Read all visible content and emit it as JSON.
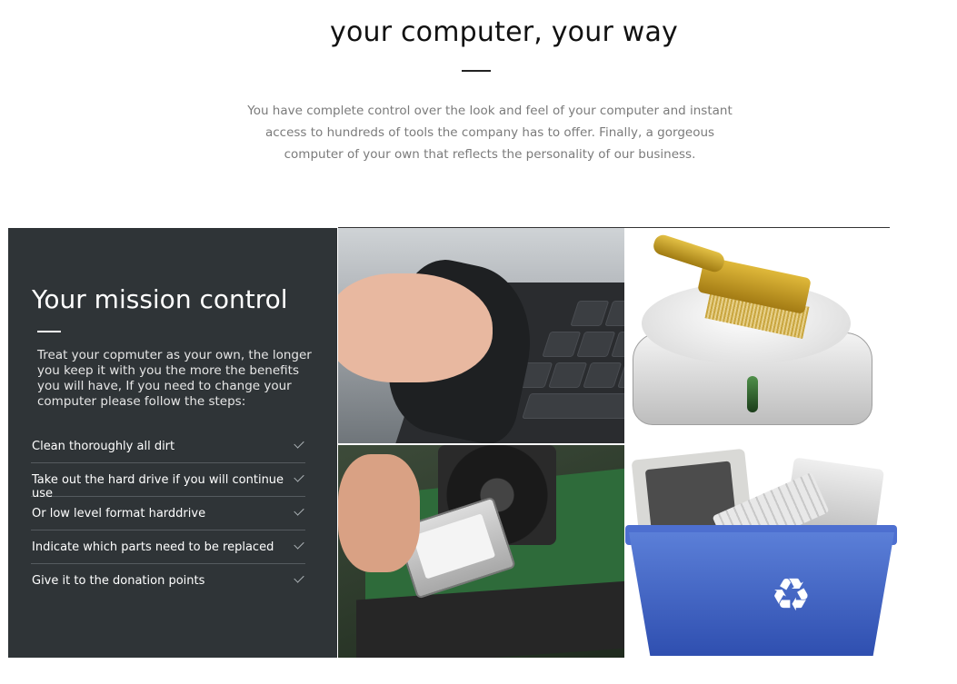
{
  "hero": {
    "title": "your computer, your way",
    "text": "You have complete control over the look and feel of your computer and instant access to hundreds of tools the company has to offer. Finally, a gorgeous computer of your own that reflects the personality of our business."
  },
  "panel": {
    "title": "Your mission control",
    "description": "Treat your copmuter as your own, the longer you keep it with you the more the benefits you will have, If you need to change your computer please follow the steps:",
    "steps": [
      {
        "label": "Clean thoroughly all dirt",
        "icon": "check-icon"
      },
      {
        "label": "Take out the hard drive if you will continue use",
        "icon": "check-icon"
      },
      {
        "label": "Or low level format harddrive",
        "icon": "check-icon"
      },
      {
        "label": "Indicate which parts need to be replaced",
        "icon": "check-icon"
      },
      {
        "label": "Give it to the donation points",
        "icon": "check-icon"
      }
    ]
  },
  "images": {
    "recycle_symbol": "♻",
    "items": [
      "laptop-keyboard-cleaning-image",
      "hard-drive-brush-image",
      "motherboard-hard-drive-image",
      "recycle-bin-computers-image"
    ]
  },
  "colors": {
    "panel_bg": "#2f3437",
    "title_text": "#111111",
    "body_text": "#7b7b7b",
    "bin_blue": "#3a5cc0"
  }
}
